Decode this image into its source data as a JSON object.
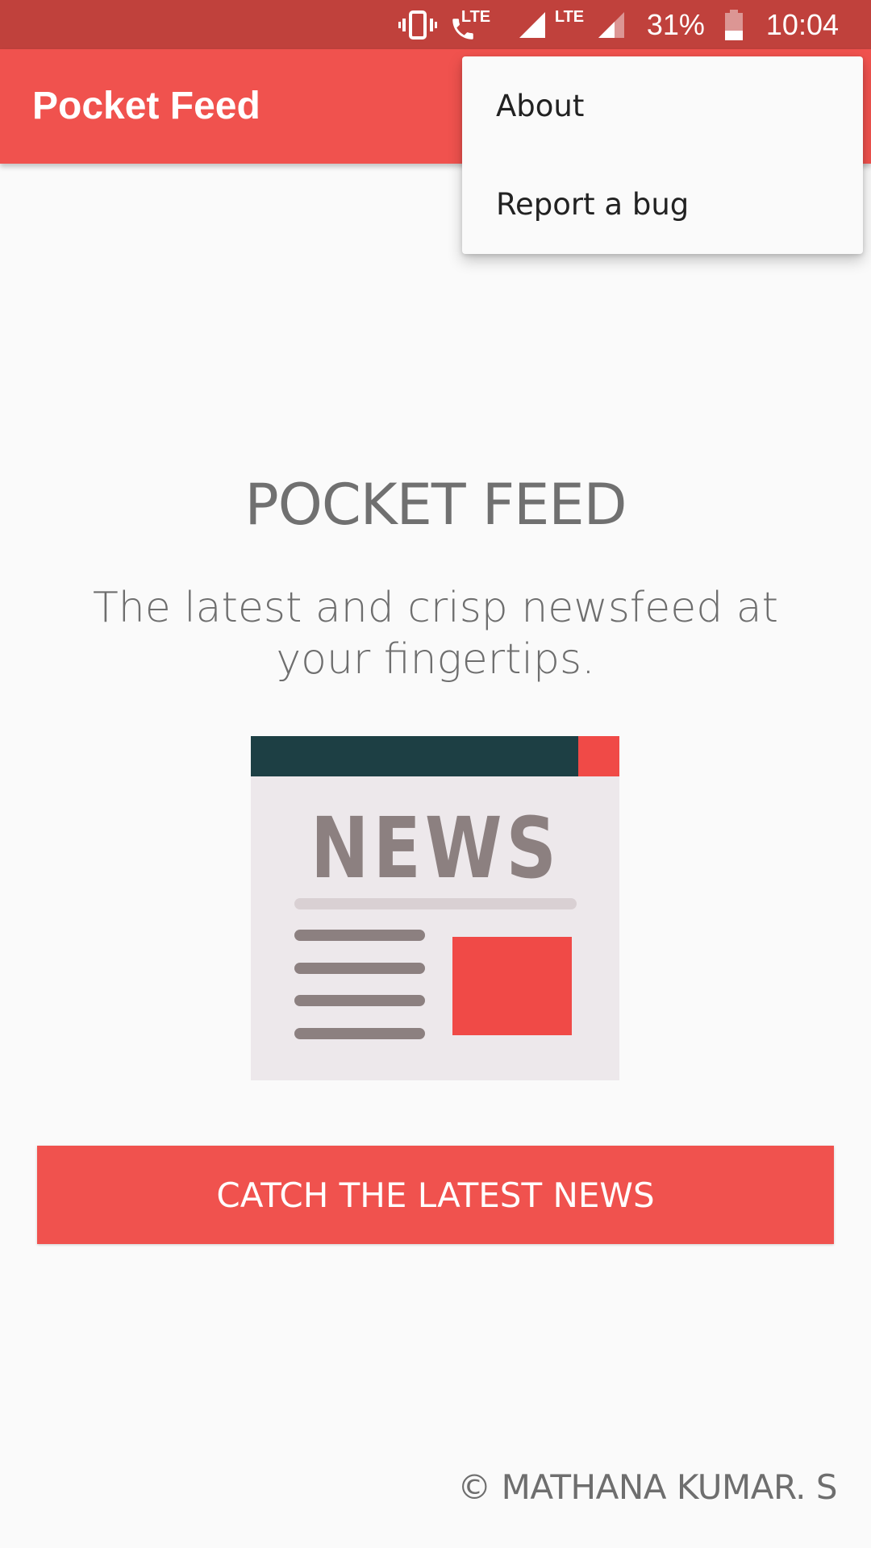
{
  "status_bar": {
    "lte_label_1": "LTE",
    "lte_label_2": "LTE",
    "battery_percent": "31%",
    "time": "10:04",
    "battery_level": 0.31,
    "icons": [
      "vibrate-icon",
      "volte-call-icon",
      "signal-icon",
      "signal-icon",
      "battery-icon"
    ]
  },
  "app_bar": {
    "title": "Pocket Feed"
  },
  "menu": {
    "items": [
      {
        "label": "About"
      },
      {
        "label": "Report a bug"
      }
    ]
  },
  "main": {
    "headline": "POCKET FEED",
    "tagline": "The latest and crisp newsfeed at your fingertips.",
    "illustration_text": "NEWS",
    "cta_label": "CATCH THE LATEST NEWS",
    "copyright": "© MATHANA KUMAR. S"
  },
  "colors": {
    "status_bar": "#c0413c",
    "app_bar": "#f0524e",
    "accent": "#f0524e",
    "background": "#fafafa",
    "news_header": "#1d3f44",
    "news_body": "#ede8eb",
    "news_ink": "#8c8080",
    "news_red": "#f04a47"
  }
}
